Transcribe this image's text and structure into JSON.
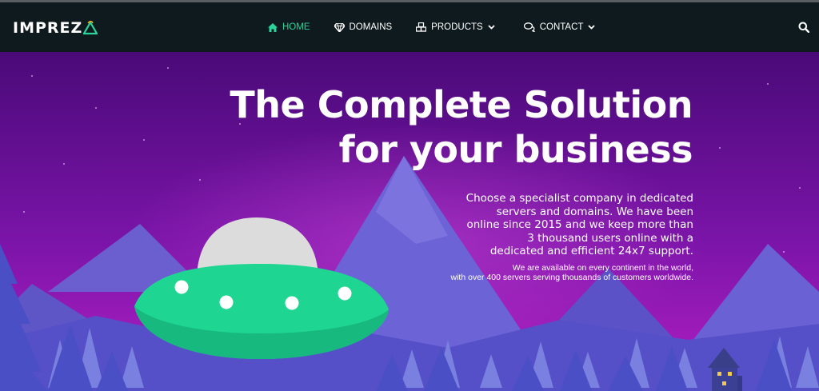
{
  "brand": {
    "name": "IMPREZ"
  },
  "nav": {
    "items": [
      {
        "label": "HOME",
        "icon": "home-icon",
        "active": true
      },
      {
        "label": "DOMAINS",
        "icon": "diamond-icon"
      },
      {
        "label": "PRODUCTS",
        "icon": "cubes-icon",
        "dropdown": true
      },
      {
        "label": "CONTACT",
        "icon": "chat-icon",
        "dropdown": true
      }
    ],
    "search_icon": "search-icon"
  },
  "hero": {
    "title_line1": "The Complete Solution",
    "title_line2": "for your business",
    "subtitle_lines": [
      "Choose a specialist company in dedicated",
      "servers and domains. We have been",
      "online since 2015 and we keep more than",
      "3 thousand users online with a",
      "dedicated and efficient 24x7 support."
    ],
    "note_lines": [
      "We are available on every continent in the world,",
      "with over 400 servers serving thousands of customers worldwide."
    ]
  },
  "colors": {
    "navbar_bg": "#0e1a1d",
    "accent": "#2bd39a",
    "sky_top": "#4a0a78",
    "sky_bottom": "#b21fc4",
    "ufo_body": "#1fd592",
    "ufo_dome": "#dcdcdc"
  }
}
